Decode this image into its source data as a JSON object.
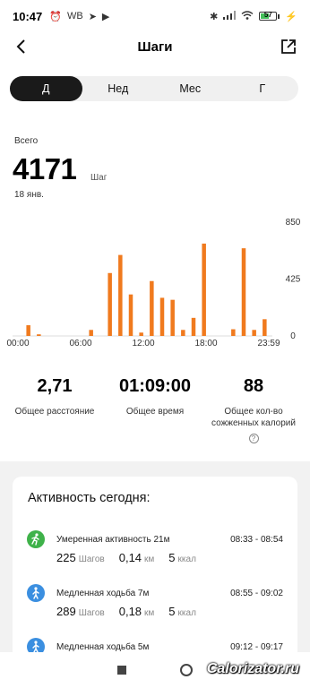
{
  "status": {
    "time": "10:47",
    "left_icons": [
      "alarm-icon",
      "WB",
      "telegram-icon",
      "play-icon"
    ],
    "battery": "57"
  },
  "header": {
    "title": "Шаги",
    "back_icon": "chevron-left-icon",
    "share_icon": "share-icon"
  },
  "tabs": [
    {
      "label": "Д",
      "active": true
    },
    {
      "label": "Нед",
      "active": false
    },
    {
      "label": "Мес",
      "active": false
    },
    {
      "label": "Г",
      "active": false
    }
  ],
  "summary": {
    "label": "Всего",
    "value": "4171",
    "unit": "Шаг",
    "date": "18 янв."
  },
  "chart_data": {
    "type": "bar",
    "color": "#f07a1e",
    "x_tick_labels": [
      "00:00",
      "06:00",
      "12:00",
      "18:00",
      "23:59"
    ],
    "y_tick_labels": [
      "850",
      "425",
      "0"
    ],
    "ylim": [
      0,
      850
    ],
    "bins": 48,
    "values": [
      0,
      0,
      80,
      15,
      0,
      0,
      0,
      0,
      0,
      0,
      0,
      50,
      0,
      0,
      0,
      0,
      0,
      600,
      0,
      0,
      0,
      0,
      0,
      55,
      0,
      0,
      0,
      0,
      0,
      0,
      0,
      0,
      0,
      0,
      0,
      0,
      0,
      0,
      0,
      0,
      0,
      0,
      0,
      0,
      0,
      0,
      0,
      0
    ],
    "bars": [
      {
        "hour": 1.0,
        "value": 80
      },
      {
        "hour": 2.0,
        "value": 12
      },
      {
        "hour": 7.0,
        "value": 45
      },
      {
        "hour": 8.8,
        "value": 470
      },
      {
        "hour": 9.8,
        "value": 605
      },
      {
        "hour": 10.8,
        "value": 310
      },
      {
        "hour": 11.8,
        "value": 25
      },
      {
        "hour": 12.8,
        "value": 410
      },
      {
        "hour": 13.8,
        "value": 285
      },
      {
        "hour": 14.8,
        "value": 270
      },
      {
        "hour": 15.8,
        "value": 45
      },
      {
        "hour": 16.8,
        "value": 135
      },
      {
        "hour": 17.8,
        "value": 690
      },
      {
        "hour": 20.6,
        "value": 50
      },
      {
        "hour": 21.6,
        "value": 655
      },
      {
        "hour": 22.6,
        "value": 45
      },
      {
        "hour": 23.6,
        "value": 125
      }
    ]
  },
  "stats": [
    {
      "value": "2,71",
      "label": "Общее расстояние"
    },
    {
      "value": "01:09:00",
      "label": "Общее время"
    },
    {
      "value": "88",
      "label": "Общее кол-во сожженных калорий"
    }
  ],
  "activity": {
    "title": "Активность сегодня:",
    "items": [
      {
        "name": "Умеренная активность 21м",
        "time": "08:33 - 08:54",
        "steps": "225",
        "steps_unit": "Шагов",
        "distance": "0,14",
        "distance_unit": "км",
        "kcal": "5",
        "kcal_unit": "ккал",
        "icon": "running-icon",
        "color": "#3fb24a"
      },
      {
        "name": "Медленная ходьба 7м",
        "time": "08:55 - 09:02",
        "steps": "289",
        "steps_unit": "Шагов",
        "distance": "0,18",
        "distance_unit": "км",
        "kcal": "5",
        "kcal_unit": "ккал",
        "icon": "walking-icon",
        "color": "#3b8fe0"
      },
      {
        "name": "Медленная ходьба 5м",
        "time": "09:12 - 09:17",
        "icon": "walking-icon",
        "color": "#3b8fe0"
      }
    ]
  },
  "watermark": "Calorizator.ru"
}
